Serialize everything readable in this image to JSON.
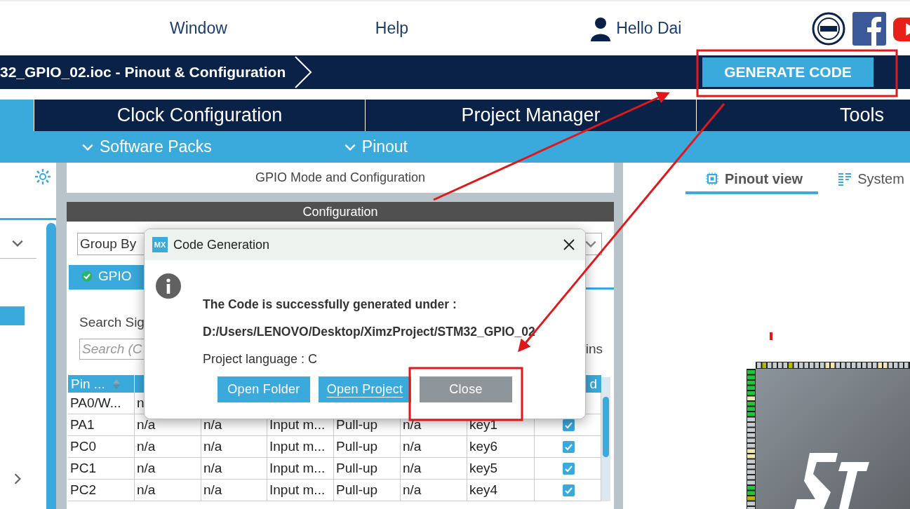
{
  "menu": [
    {
      "label": "Window"
    },
    {
      "label": "Help"
    }
  ],
  "user": {
    "label": "Hello Dai"
  },
  "breadcrumb": {
    "title": "32_GPIO_02.ioc - Pinout & Configuration",
    "action": "GENERATE CODE"
  },
  "tabs": [
    {
      "selected": true
    },
    {
      "label": "Clock Configuration",
      "selected": false
    },
    {
      "label": "Project Manager",
      "selected": false
    },
    {
      "label": "Tools",
      "selected": false
    }
  ],
  "subnav": [
    {
      "label": "Software Packs"
    },
    {
      "label": "Pinout"
    }
  ],
  "mode_panel": {
    "title": "GPIO Mode and Configuration",
    "section": "Configuration",
    "group_by": "Group By",
    "tabs": [
      {
        "label": "GPIO",
        "selected": true
      }
    ],
    "search_label": "Search Sig",
    "search_placeholder": "Search (C",
    "side_label": "ins",
    "table": {
      "header": [
        "Pin ..."
      ],
      "header_last": "d",
      "rows": [
        {
          "cells": [
            "PA0/W...",
            "n"
          ]
        },
        {
          "cells": [
            "PA1",
            "n/a",
            "n/a",
            "Input m...",
            "Pull-up",
            "n/a",
            "key1"
          ],
          "checked": true
        },
        {
          "cells": [
            "PC0",
            "n/a",
            "n/a",
            "Input m...",
            "Pull-up",
            "n/a",
            "key6"
          ],
          "checked": true
        },
        {
          "cells": [
            "PC1",
            "n/a",
            "n/a",
            "Input m...",
            "Pull-up",
            "n/a",
            "key5"
          ],
          "checked": true
        },
        {
          "cells": [
            "PC2",
            "n/a",
            "n/a",
            "Input m...",
            "Pull-up",
            "n/a",
            "key4"
          ],
          "checked": true
        }
      ]
    }
  },
  "right_panel": {
    "tabs": [
      {
        "label": "Pinout view",
        "selected": true
      },
      {
        "label": "System",
        "selected": false
      }
    ]
  },
  "dialog": {
    "badge": "MX",
    "title": "Code Generation",
    "message": "The Code is successfully generated under :",
    "path": "D:/Users/LENOVO/Desktop/XimzProject/STM32_GPIO_02",
    "language": "Project language : C",
    "buttons": [
      {
        "label": "Open Folder",
        "kind": "primary",
        "focused": false
      },
      {
        "label": "Open Project",
        "kind": "primary",
        "focused": true
      },
      {
        "label": "Close",
        "kind": "secondary",
        "focused": false
      }
    ]
  }
}
